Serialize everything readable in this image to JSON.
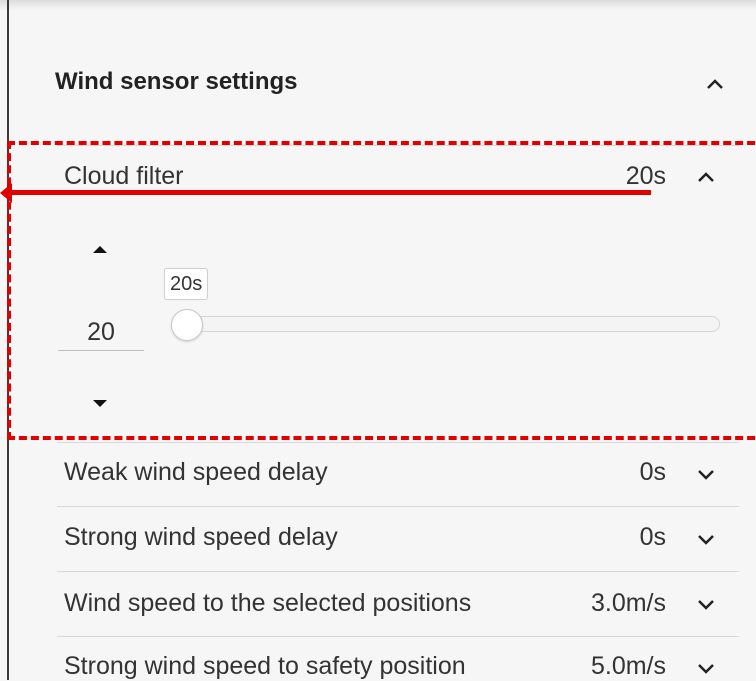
{
  "section": {
    "title": "Wind sensor settings",
    "expanded_icon": "chevron-up-icon"
  },
  "cloud_filter": {
    "label": "Cloud filter",
    "value": "20s",
    "icon": "chevron-up-icon",
    "spinner_value": "20",
    "slider_tooltip": "20s",
    "slider_fraction": 0.0
  },
  "rows": [
    {
      "label": "Weak wind speed delay",
      "value": "0s",
      "icon": "chevron-down-icon"
    },
    {
      "label": "Strong wind speed delay",
      "value": "0s",
      "icon": "chevron-down-icon"
    },
    {
      "label": "Wind speed to the selected positions",
      "value": "3.0m/s",
      "icon": "chevron-down-icon"
    },
    {
      "label": "Strong wind speed to safety position",
      "value": "5.0m/s",
      "icon": "chevron-down-icon"
    }
  ],
  "colors": {
    "annotation": "#e00000",
    "background": "#f6f6f6"
  }
}
